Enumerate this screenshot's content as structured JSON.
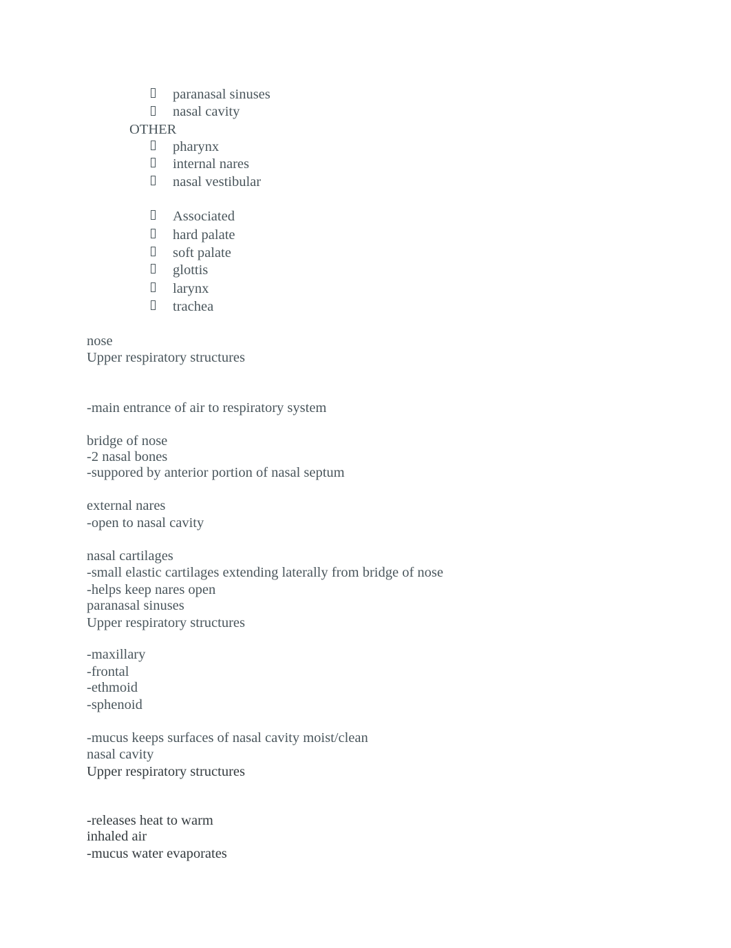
{
  "outline": {
    "top_items": [
      "paranasal sinuses",
      "nasal cavity"
    ],
    "other_heading": "OTHER",
    "other_items": [
      "pharynx",
      "internal nares",
      "nasal vestibular"
    ],
    "associated_items": [
      "Associated",
      "hard palate",
      "soft palate",
      "glottis",
      "larynx",
      "trachea"
    ]
  },
  "sections": {
    "nose": {
      "term": "nose",
      "category": "Upper respiratory structures",
      "definition": "-main entrance of air to respiratory system",
      "bridge_title": "bridge of nose",
      "bridge_points": [
        "-2 nasal bones",
        "-suppored by anterior portion of nasal septum"
      ],
      "nares_title": "external nares",
      "nares_points": [
        "-open to nasal cavity"
      ],
      "cartilage_title": "nasal cartilages",
      "cartilage_points": [
        "-small elastic cartilages extending laterally from bridge of nose",
        "-helps keep nares open"
      ]
    },
    "paranasal": {
      "term": "paranasal sinuses",
      "category": "Upper respiratory structures",
      "points": [
        "-maxillary",
        "-frontal",
        "-ethmoid",
        "-sphenoid"
      ],
      "note": "-mucus keeps surfaces of nasal cavity moist/clean"
    },
    "nasal_cavity": {
      "term": "nasal cavity",
      "category": "Upper respiratory structures",
      "points": [
        "-releases heat to warm",
        "inhaled air",
        "-mucus water evaporates"
      ]
    }
  }
}
